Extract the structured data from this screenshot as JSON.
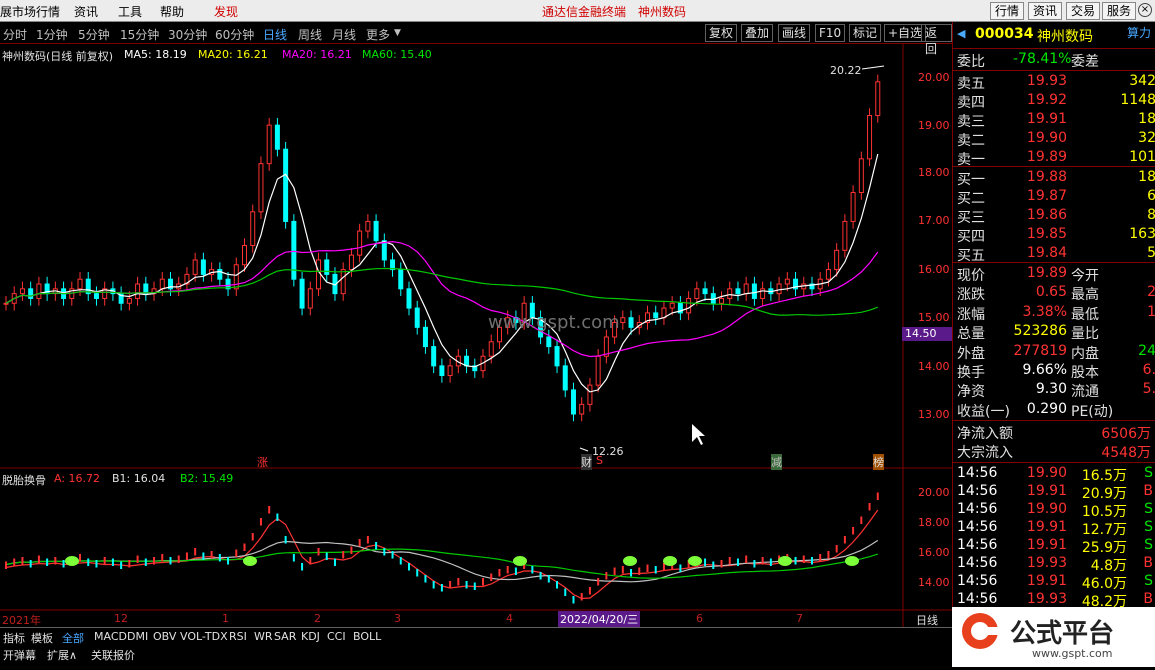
{
  "topbar": {
    "items": [
      "展市场行情",
      "资讯",
      "工具",
      "帮助"
    ],
    "found": "发现",
    "center_links": [
      "通达信金融终端",
      "神州数码"
    ],
    "right_buttons": [
      "行情",
      "资讯",
      "交易",
      "服务"
    ]
  },
  "periodbar": {
    "periods": [
      "分时",
      "1分钟",
      "5分钟",
      "15分钟",
      "30分钟",
      "60分钟",
      "日线",
      "周线",
      "月线",
      "更多"
    ],
    "active": "日线",
    "tools": [
      "复权",
      "叠加",
      "画线",
      "F10",
      "标记",
      "+自选",
      "返回"
    ]
  },
  "main_chart": {
    "title": "神州数码(日线 前复权)",
    "ma5": "MA5: 18.19",
    "ma20": "MA20: 16.21",
    "ma30": "MA20: 16.21",
    "ma60": "MA60: 15.40",
    "high_label": "20.22",
    "low_label": "12.26",
    "cursor_price": "14.50",
    "watermark": "www.gspt.com",
    "markers": [
      "涨",
      "财",
      "S",
      "减",
      "榜"
    ]
  },
  "sub_chart": {
    "title": "脱胎换骨",
    "a": "A: 16.72",
    "b1": "B1: 16.04",
    "b2": "B2: 15.49"
  },
  "axis": {
    "price_ticks": [
      "20.00",
      "19.00",
      "18.00",
      "17.00",
      "16.00",
      "15.00",
      "14.00",
      "13.00"
    ],
    "sub_ticks": [
      "20.00",
      "18.00",
      "16.00",
      "14.00"
    ],
    "date_ticks": [
      "2021年",
      "12",
      "1",
      "2",
      "3",
      "4",
      "2022/04/20/三",
      "6",
      "7"
    ],
    "period_label": "日线"
  },
  "bottombar": {
    "tabs": [
      "指标",
      "模板",
      "全部",
      "MACD",
      "DMI",
      "OBV",
      "VOL-TDX",
      "RSI",
      "WR",
      "SAR",
      "KDJ",
      "CCI",
      "BOLL"
    ],
    "tabs2": [
      "开弹幕",
      "扩展∧",
      "关联报价"
    ]
  },
  "quote": {
    "code": "000034",
    "name": "神州数码",
    "suanli": "算力",
    "weibi_label": "委比",
    "weibi": "-78.41%",
    "weicha_label": "委差",
    "sells": [
      {
        "label": "卖五",
        "price": "19.93",
        "vol": "342"
      },
      {
        "label": "卖四",
        "price": "19.92",
        "vol": "1148"
      },
      {
        "label": "卖三",
        "price": "19.91",
        "vol": "18"
      },
      {
        "label": "卖二",
        "price": "19.90",
        "vol": "32"
      },
      {
        "label": "卖一",
        "price": "19.89",
        "vol": "101"
      }
    ],
    "buys": [
      {
        "label": "买一",
        "price": "19.88",
        "vol": "18"
      },
      {
        "label": "买二",
        "price": "19.87",
        "vol": "6"
      },
      {
        "label": "买三",
        "price": "19.86",
        "vol": "8"
      },
      {
        "label": "买四",
        "price": "19.85",
        "vol": "163"
      },
      {
        "label": "买五",
        "price": "19.84",
        "vol": "5"
      }
    ],
    "stats": [
      {
        "l1": "现价",
        "v1": "19.89",
        "l2": "今开",
        "v2": ""
      },
      {
        "l1": "涨跌",
        "v1": "0.65",
        "l2": "最高",
        "v2": "2"
      },
      {
        "l1": "涨幅",
        "v1": "3.38%",
        "l2": "最低",
        "v2": "1"
      },
      {
        "l1": "总量",
        "v1": "523286",
        "l2": "量比",
        "v2": ""
      },
      {
        "l1": "外盘",
        "v1": "277819",
        "l2": "内盘",
        "v2": "24"
      },
      {
        "l1": "换手",
        "v1": "9.66%",
        "l2": "股本",
        "v2": "6."
      },
      {
        "l1": "净资",
        "v1": "9.30",
        "l2": "流通",
        "v2": "5."
      },
      {
        "l1": "收益(一)",
        "v1": "0.290",
        "l2": "PE(动)",
        "v2": ""
      }
    ],
    "flow": [
      {
        "label": "净流入额",
        "value": "6506万"
      },
      {
        "label": "大宗流入",
        "value": "4548万"
      }
    ],
    "ticks": [
      {
        "time": "14:56",
        "price": "19.90",
        "vol": "16.5万",
        "bs": "S"
      },
      {
        "time": "14:56",
        "price": "19.91",
        "vol": "20.9万",
        "bs": "B"
      },
      {
        "time": "14:56",
        "price": "19.90",
        "vol": "10.5万",
        "bs": "S"
      },
      {
        "time": "14:56",
        "price": "19.91",
        "vol": "12.7万",
        "bs": "S"
      },
      {
        "time": "14:56",
        "price": "19.91",
        "vol": "25.9万",
        "bs": "S"
      },
      {
        "time": "14:56",
        "price": "19.93",
        "vol": "4.8万",
        "bs": "B"
      },
      {
        "time": "14:56",
        "price": "19.91",
        "vol": "46.0万",
        "bs": "S"
      },
      {
        "time": "14:56",
        "price": "19.93",
        "vol": "48.2万",
        "bs": "B"
      }
    ]
  },
  "badge": {
    "text": "公式平台",
    "url": "www.gspt.com"
  },
  "colors": {
    "up": "#ff3232",
    "down": "#00ffff",
    "ma5": "#ffffff",
    "ma20": "#ff00ff",
    "ma60": "#00c800",
    "highlight": "#4aa8ff"
  }
}
